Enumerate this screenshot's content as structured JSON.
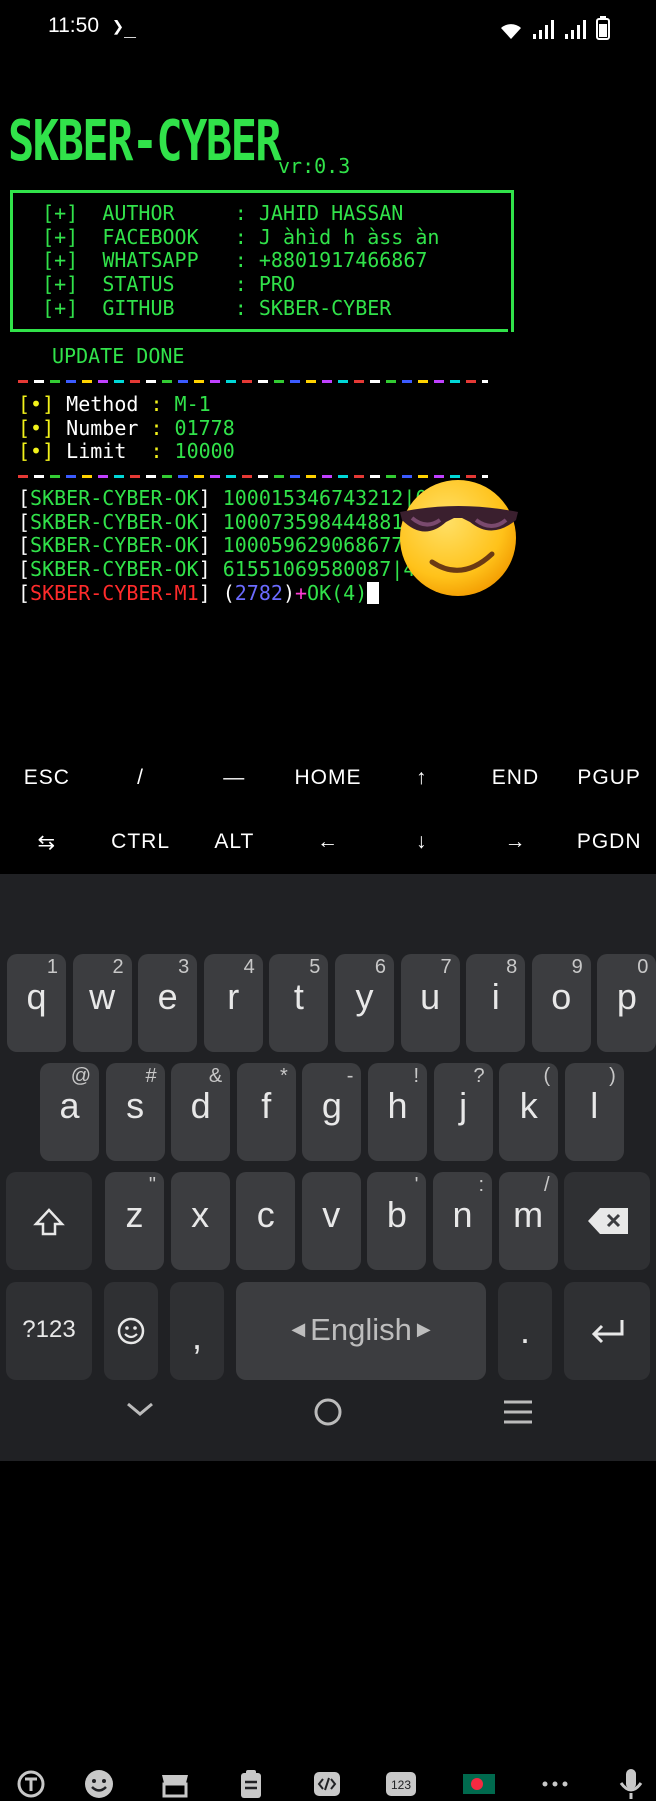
{
  "status_bar": {
    "time": "11:50",
    "terminal_indicator": "❯_"
  },
  "banner": {
    "logo": "SKBER-CYBER",
    "version": "vr:0.3"
  },
  "info": [
    {
      "mark": "[+]",
      "key": "AUTHOR   ",
      "value": "JAHID HASSAN"
    },
    {
      "mark": "[+]",
      "key": "FACEBOOK ",
      "value": "J àhìd h àss àn"
    },
    {
      "mark": "[+]",
      "key": "WHATSAPP ",
      "value": "+8801917466867"
    },
    {
      "mark": "[+]",
      "key": "STATUS   ",
      "value": "PRO"
    },
    {
      "mark": "[+]",
      "key": "GITHUB   ",
      "value": "SKBER-CYBER"
    }
  ],
  "update_text": "UPDATE DONE",
  "params": [
    {
      "mark": "[•]",
      "key": "Method",
      "sep": " : ",
      "value": "M-1"
    },
    {
      "mark": "[•]",
      "key": "Number",
      "sep": " : ",
      "value": "01778"
    },
    {
      "mark": "[•]",
      "key": "Limit ",
      "sep": " : ",
      "value": "10000"
    }
  ],
  "results": [
    {
      "tag": "SKBER-CYBER-OK",
      "text": "100015346743212|0"
    },
    {
      "tag": "SKBER-CYBER-OK",
      "text": "100073598444881"
    },
    {
      "tag": "SKBER-CYBER-OK",
      "text": "100059629068677"
    },
    {
      "tag": "SKBER-CYBER-OK",
      "text": "61551069580087|4"
    }
  ],
  "progress": {
    "tag": "SKBER-CYBER-M1",
    "count": "2782",
    "ok": "OK(4)"
  },
  "extra_keys": {
    "row1": [
      "ESC",
      "/",
      "―",
      "HOME",
      "↑",
      "END",
      "PGUP"
    ],
    "row2": [
      "⇆",
      "CTRL",
      "ALT",
      "←",
      "↓",
      "→",
      "PGDN"
    ]
  },
  "keyboard": {
    "row1": [
      [
        "q",
        "1"
      ],
      [
        "w",
        "2"
      ],
      [
        "e",
        "3"
      ],
      [
        "r",
        "4"
      ],
      [
        "t",
        "5"
      ],
      [
        "y",
        "6"
      ],
      [
        "u",
        "7"
      ],
      [
        "i",
        "8"
      ],
      [
        "o",
        "9"
      ],
      [
        "p",
        "0"
      ]
    ],
    "row2": [
      [
        "a",
        "@"
      ],
      [
        "s",
        "#"
      ],
      [
        "d",
        "&"
      ],
      [
        "f",
        "*"
      ],
      [
        "g",
        "-"
      ],
      [
        "h",
        "!"
      ],
      [
        "j",
        "?"
      ],
      [
        "k",
        "("
      ],
      [
        "l",
        ")"
      ]
    ],
    "row3": [
      [
        "z",
        "\""
      ],
      [
        "x",
        ""
      ],
      [
        "c",
        ""
      ],
      [
        "v",
        ""
      ],
      [
        "b",
        "'"
      ],
      [
        "n",
        ":"
      ],
      [
        "m",
        "/"
      ]
    ],
    "symbols_label": "?123",
    "comma": ",",
    "space_label": "English",
    "period": "."
  },
  "colors": {
    "terminal_green": "#31e24a",
    "keyboard_bg": "#202124",
    "key_bg": "#3c3d40"
  }
}
